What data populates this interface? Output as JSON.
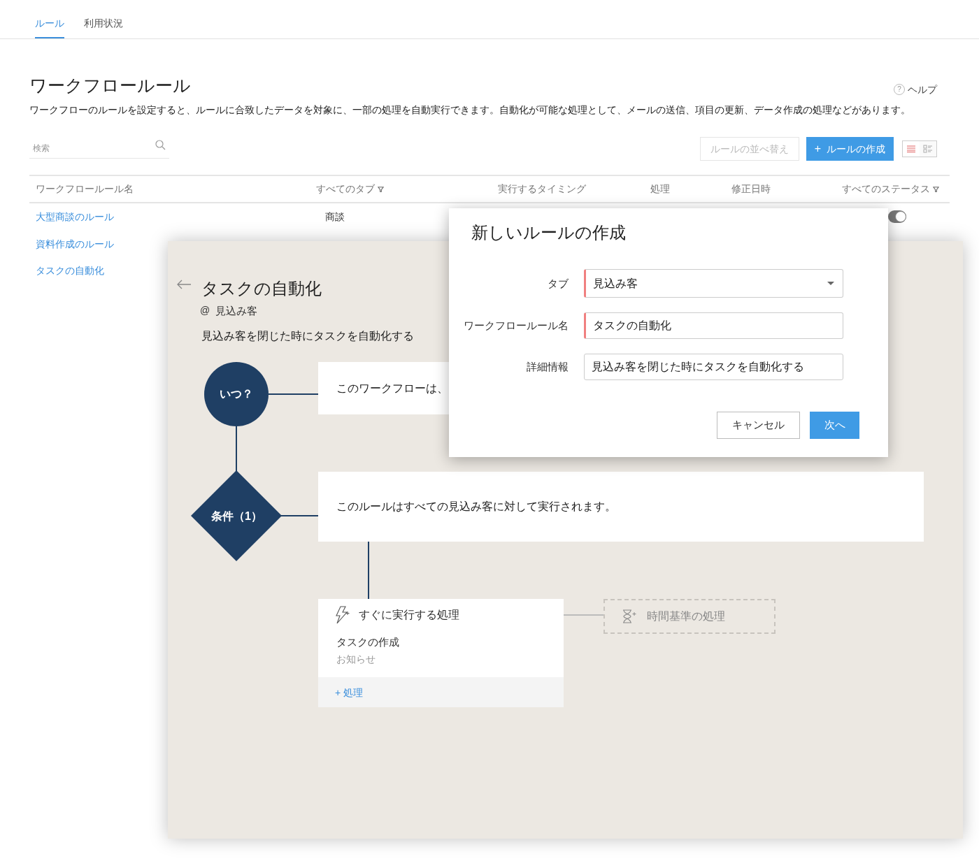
{
  "tabs": [
    {
      "label": "ルール",
      "selected": true
    },
    {
      "label": "利用状況",
      "selected": false
    }
  ],
  "page": {
    "title": "ワークフロールール",
    "help": "ヘルプ",
    "help_icon": "?",
    "description": "ワークフローのルールを設定すると、ルールに合致したデータを対象に、一部の処理を自動実行できます。自動化が可能な処理として、メールの送信、項目の更新、データ作成の処理などがあります。"
  },
  "search": {
    "placeholder": "検索"
  },
  "toolbar": {
    "sort_button": "ルールの並べ替え",
    "create_button": "ルールの作成",
    "create_icon": "+",
    "view_modes": [
      {
        "kind": "list",
        "selected": true
      },
      {
        "kind": "grid",
        "selected": false
      }
    ]
  },
  "table": {
    "columns": [
      {
        "label": "ワークフロールール名",
        "filter": false
      },
      {
        "label": "すべてのタブ",
        "filter": true
      },
      {
        "label": "実行するタイミング",
        "filter": false
      },
      {
        "label": "処理",
        "filter": false
      },
      {
        "label": "修正日時",
        "filter": false
      },
      {
        "label": "すべてのステータス",
        "filter": true
      }
    ],
    "rows": [
      {
        "name": "大型商談のルール",
        "tab": "商談",
        "on": true
      },
      {
        "name": "資料作成のルール"
      },
      {
        "name": "タスクの自動化"
      }
    ]
  },
  "workflow": {
    "title": "タスクの自動化",
    "module_prefix": "@",
    "module": "見込み客",
    "description": "見込み客を閉じた時にタスクを自動化する",
    "when_node": "いつ？",
    "when_text": "このワークフローは、",
    "condition_node": "条件（1）",
    "condition_text": "このルールはすべての見込み客に対して実行されます。",
    "instant": {
      "title": "すぐに実行する処理",
      "action": "タスクの作成",
      "action_type": "お知らせ",
      "add": "+ 処理"
    },
    "scheduled": "時間基準の処理"
  },
  "dialog": {
    "title": "新しいルールの作成",
    "fields": [
      {
        "label": "タブ",
        "value": "見込み客",
        "kind": "select",
        "required": true
      },
      {
        "label": "ワークフロールール名",
        "value": "タスクの自動化",
        "kind": "text",
        "required": true
      },
      {
        "label": "詳細情報",
        "value": "見込み客を閉じた時にタスクを自動化する",
        "kind": "text",
        "required": false
      }
    ],
    "cancel": "キャンセル",
    "next": "次へ"
  }
}
